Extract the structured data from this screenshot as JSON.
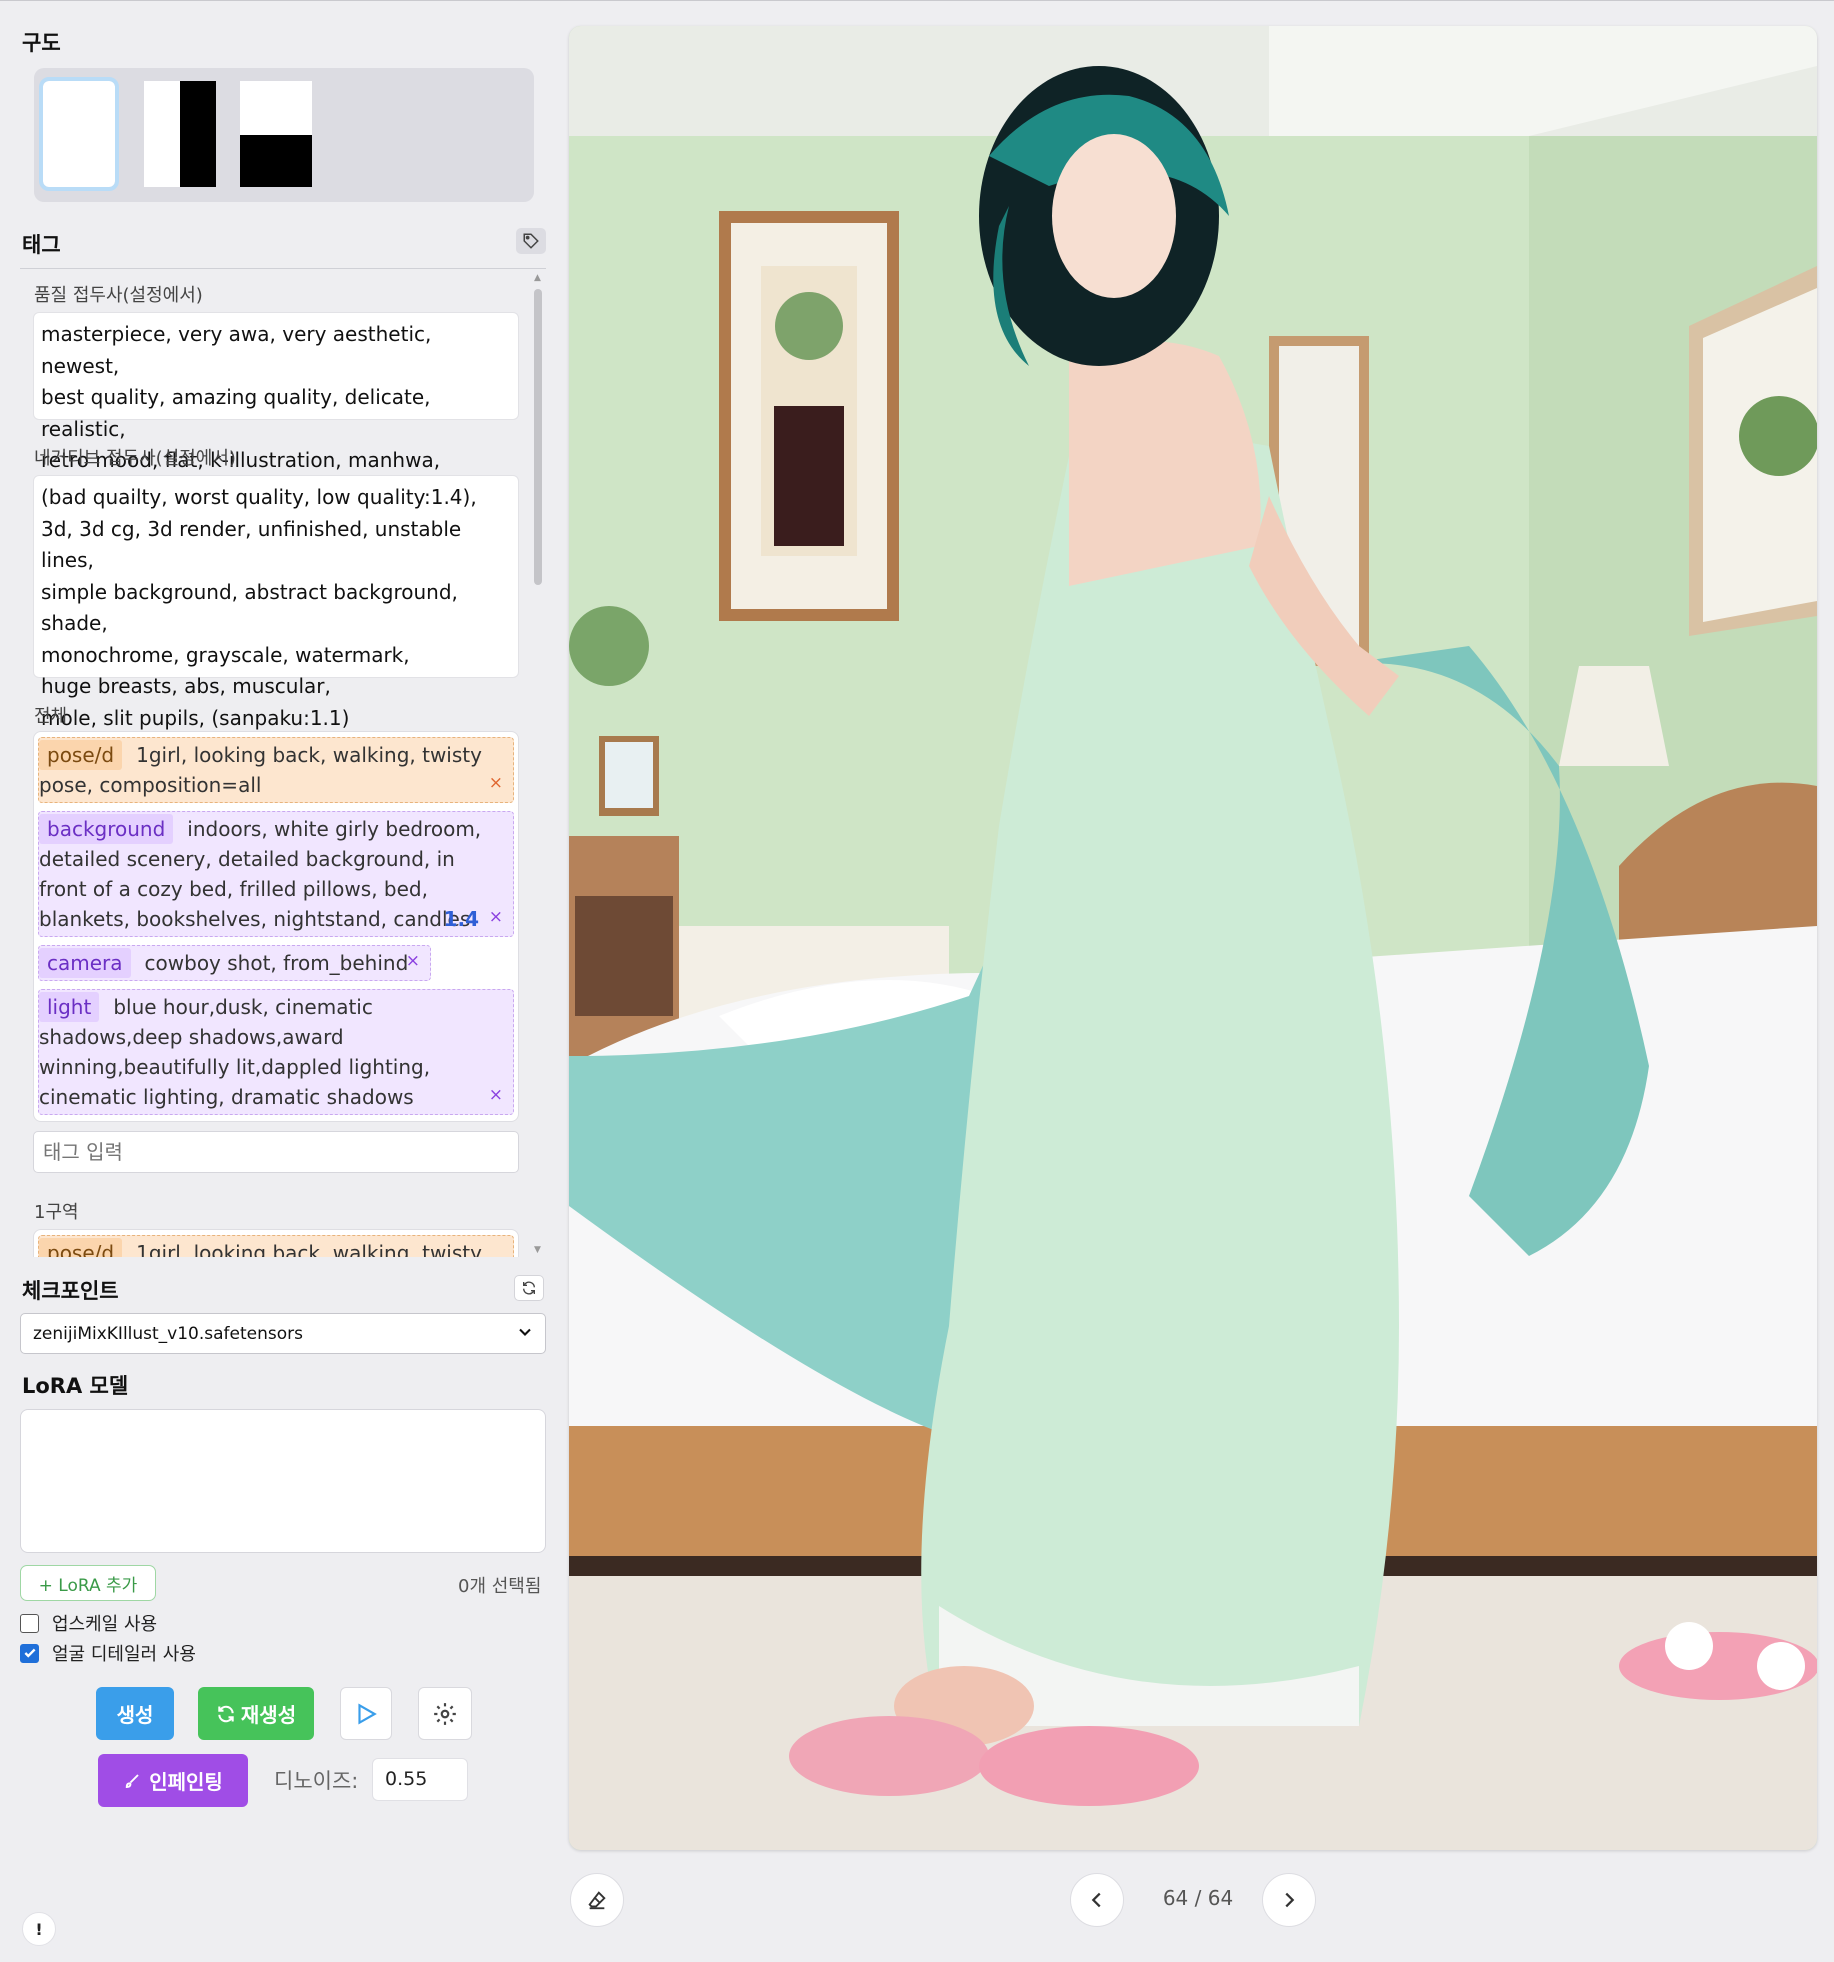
{
  "composition": {
    "title": "구도"
  },
  "tags": {
    "title": "태그",
    "quality_label": "품질 접두사(설정에서)",
    "quality_text": "masterpiece, very awa, very aesthetic, newest,\nbest quality, amazing quality, delicate, realistic,\nretro mood, flat, k-illustration, manhwa, webtoon",
    "negative_label": "네거티브 접두사(설정에서)",
    "negative_text": "(bad quailty, worst quality, low quality:1.4),\n3d, 3d cg, 3d render, unfinished, unstable lines,\nsimple background, abstract background, shade,\nmonochrome, grayscale, watermark,\nhuge breasts, abs, muscular,\nmole, slit pupils, (sanpaku:1.1)",
    "whole_label": "전체",
    "chips": [
      {
        "category": "pose/d",
        "text": "1girl, looking back, walking, twisty pose, composition=all",
        "weight": ""
      },
      {
        "category": "background",
        "text": "indoors, white girly bedroom, detailed scenery, detailed background, in front of a cozy bed, frilled pillows, bed, blankets, bookshelves, nightstand, candles",
        "weight": "1.4"
      },
      {
        "category": "camera",
        "text": "cowboy shot, from_behind",
        "weight": ""
      },
      {
        "category": "light",
        "text": "blue hour,dusk, cinematic shadows,deep shadows,award winning,beautifully lit,dappled lighting, cinematic lighting, dramatic shadows",
        "weight": ""
      }
    ],
    "remove_symbol": "×",
    "input_placeholder": "태그 입력",
    "region1_label": "1구역",
    "region1_chip": {
      "category": "pose/d",
      "text": "1girl, looking back, walking, twisty"
    }
  },
  "checkpoint": {
    "title": "체크포인트",
    "selected": "zenijiMixKIllust_v10.safetensors"
  },
  "lora": {
    "title": "LoRA 모델",
    "add_label": "+ LoRA 추가",
    "count_label": "0개 선택됨"
  },
  "options": {
    "upscale": {
      "label": "업스케일 사용",
      "checked": false
    },
    "face_detailer": {
      "label": "얼굴 디테일러 사용",
      "checked": true
    }
  },
  "actions": {
    "generate": "생성",
    "regenerate": "재생성",
    "inpaint": "인페인팅",
    "denoise_label": "디노이즈:",
    "denoise_value": "0.55",
    "alert": "!"
  },
  "viewer": {
    "current": "64",
    "separator": "/",
    "total": "64"
  },
  "colors": {
    "generate": "#3a9eea",
    "regenerate": "#46c35a",
    "inpaint": "#a04de6",
    "orange_chip": "#fde6cf",
    "purple_chip": "#f1e6ff"
  }
}
